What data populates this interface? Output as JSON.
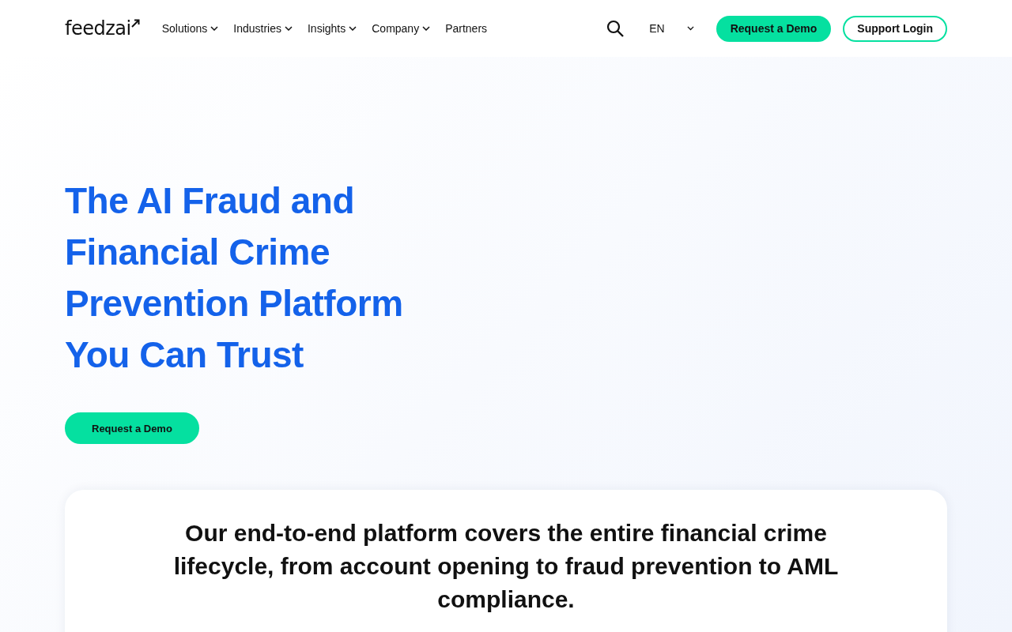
{
  "header": {
    "logo": "feedzai",
    "nav": [
      {
        "label": "Solutions",
        "has_menu": true
      },
      {
        "label": "Industries",
        "has_menu": true
      },
      {
        "label": "Insights",
        "has_menu": true
      },
      {
        "label": "Company",
        "has_menu": true
      },
      {
        "label": "Partners",
        "has_menu": false
      }
    ],
    "language": "EN",
    "demo_button": "Request a Demo",
    "login_button": "Support Login"
  },
  "hero": {
    "title": "The AI Fraud and Financial Crime Prevention Platform You Can Trust",
    "button": "Request a Demo"
  },
  "platform_card": {
    "text": "Our end-to-end platform covers the entire financial crime lifecycle, from account opening to fraud prevention to AML compliance."
  }
}
